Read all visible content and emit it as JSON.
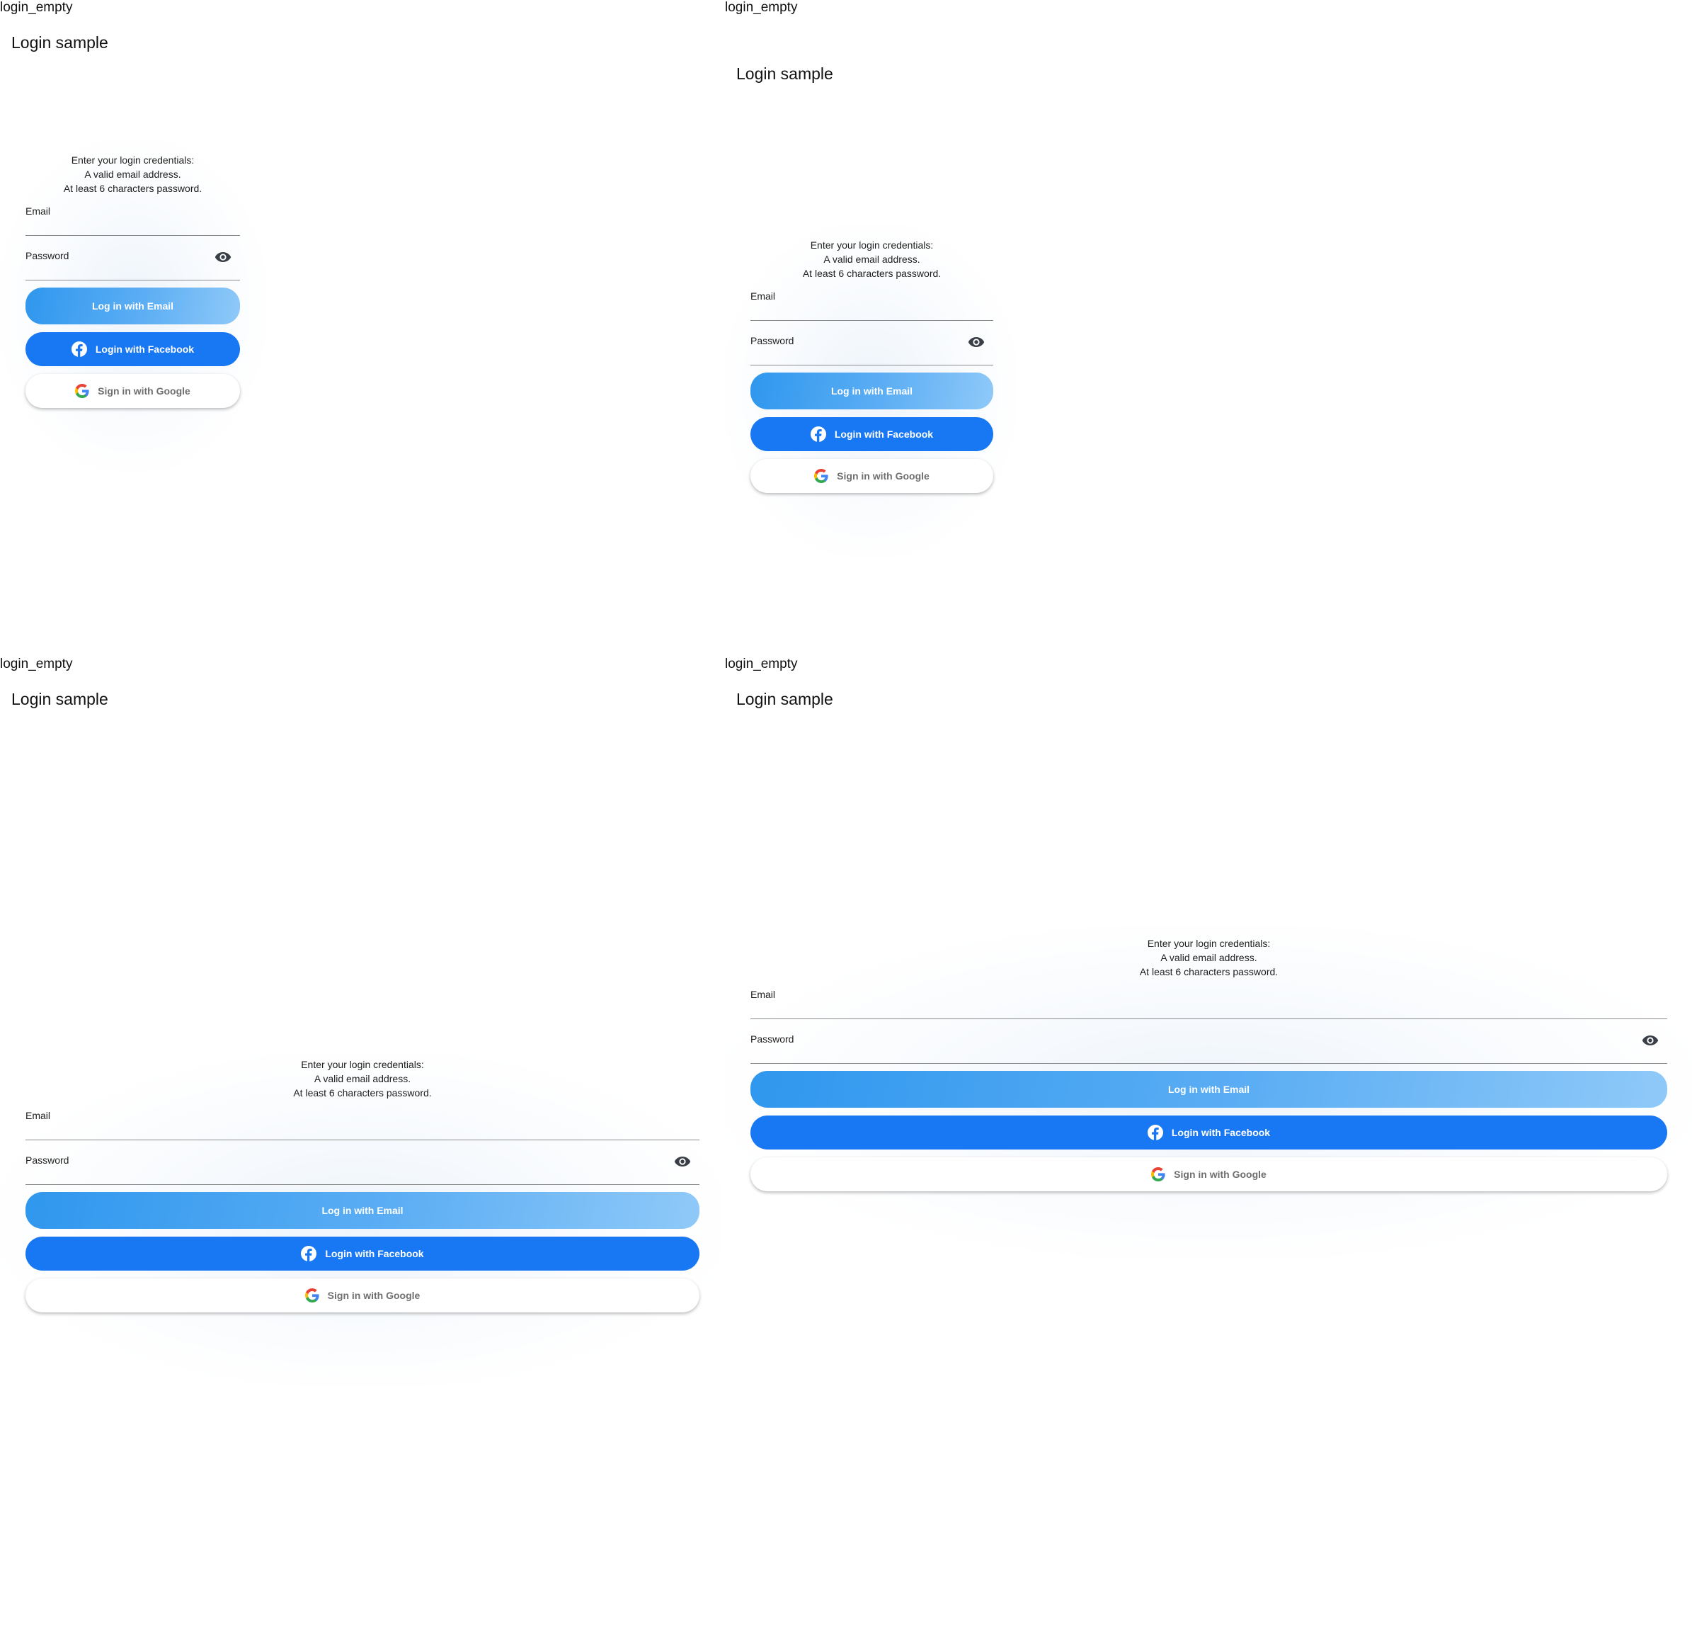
{
  "panels": [
    {
      "label": "login_empty",
      "app_title": "Login sample",
      "hint_lines": [
        "Enter your login credentials:",
        "A valid email address.",
        "At least 6 characters password."
      ],
      "email_label": "Email",
      "email_value": "",
      "password_label": "Password",
      "password_value": "",
      "email_button": "Log in with Email",
      "facebook_button": "Login with Facebook",
      "google_button": "Sign in with Google"
    },
    {
      "label": "login_empty",
      "app_title": "Login sample",
      "hint_lines": [
        "Enter your login credentials:",
        "A valid email address.",
        "At least 6 characters password."
      ],
      "email_label": "Email",
      "email_value": "",
      "password_label": "Password",
      "password_value": "",
      "email_button": "Log in with Email",
      "facebook_button": "Login with Facebook",
      "google_button": "Sign in with Google"
    },
    {
      "label": "login_empty",
      "app_title": "Login sample",
      "hint_lines": [
        "Enter your login credentials:",
        "A valid email address.",
        "At least 6 characters password."
      ],
      "email_label": "Email",
      "email_value": "",
      "password_label": "Password",
      "password_value": "",
      "email_button": "Log in with Email",
      "facebook_button": "Login with Facebook",
      "google_button": "Sign in with Google"
    },
    {
      "label": "login_empty",
      "app_title": "Login sample",
      "hint_lines": [
        "Enter your login credentials:",
        "A valid email address.",
        "At least 6 characters password."
      ],
      "email_label": "Email",
      "email_value": "",
      "password_label": "Password",
      "password_value": "",
      "email_button": "Log in with Email",
      "facebook_button": "Login with Facebook",
      "google_button": "Sign in with Google"
    }
  ],
  "colors": {
    "facebook_blue": "#1877f2",
    "email_gradient_start": "#2f97ee",
    "email_gradient_end": "#8fc9f8",
    "google_text": "#6f6f6f"
  },
  "icons": {
    "password_toggle": "eye-icon",
    "facebook": "facebook-logo-icon",
    "google": "google-logo-icon"
  }
}
